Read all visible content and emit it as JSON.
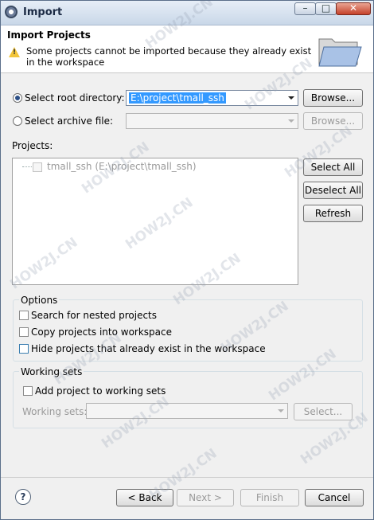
{
  "window": {
    "title": "Import",
    "minimize": "–",
    "maximize": "□",
    "close": "✕"
  },
  "banner": {
    "title": "Import Projects",
    "message": "Some projects cannot be imported because they already exist in the workspace"
  },
  "source": {
    "root_label": "Select root directory:",
    "root_value": "E:\\project\\tmall_ssh",
    "archive_label": "Select archive file:",
    "archive_value": "",
    "browse_label": "Browse...",
    "browse_archive_label": "Browse..."
  },
  "projects": {
    "label": "Projects:",
    "items": [
      {
        "label": "tmall_ssh (E:\\project\\tmall_ssh)"
      }
    ],
    "select_all": "Select All",
    "deselect_all": "Deselect All",
    "refresh": "Refresh"
  },
  "options": {
    "title": "Options",
    "search_nested": "Search for nested projects",
    "copy_projects": "Copy projects into workspace",
    "hide_projects": "Hide projects that already exist in the workspace"
  },
  "working_sets": {
    "title": "Working sets",
    "add_project": "Add project to working sets",
    "sets_label": "Working sets:",
    "select_label": "Select..."
  },
  "footer": {
    "help": "?",
    "back": "< Back",
    "next": "Next >",
    "finish": "Finish",
    "cancel": "Cancel"
  },
  "watermark": "HOW2J.CN"
}
